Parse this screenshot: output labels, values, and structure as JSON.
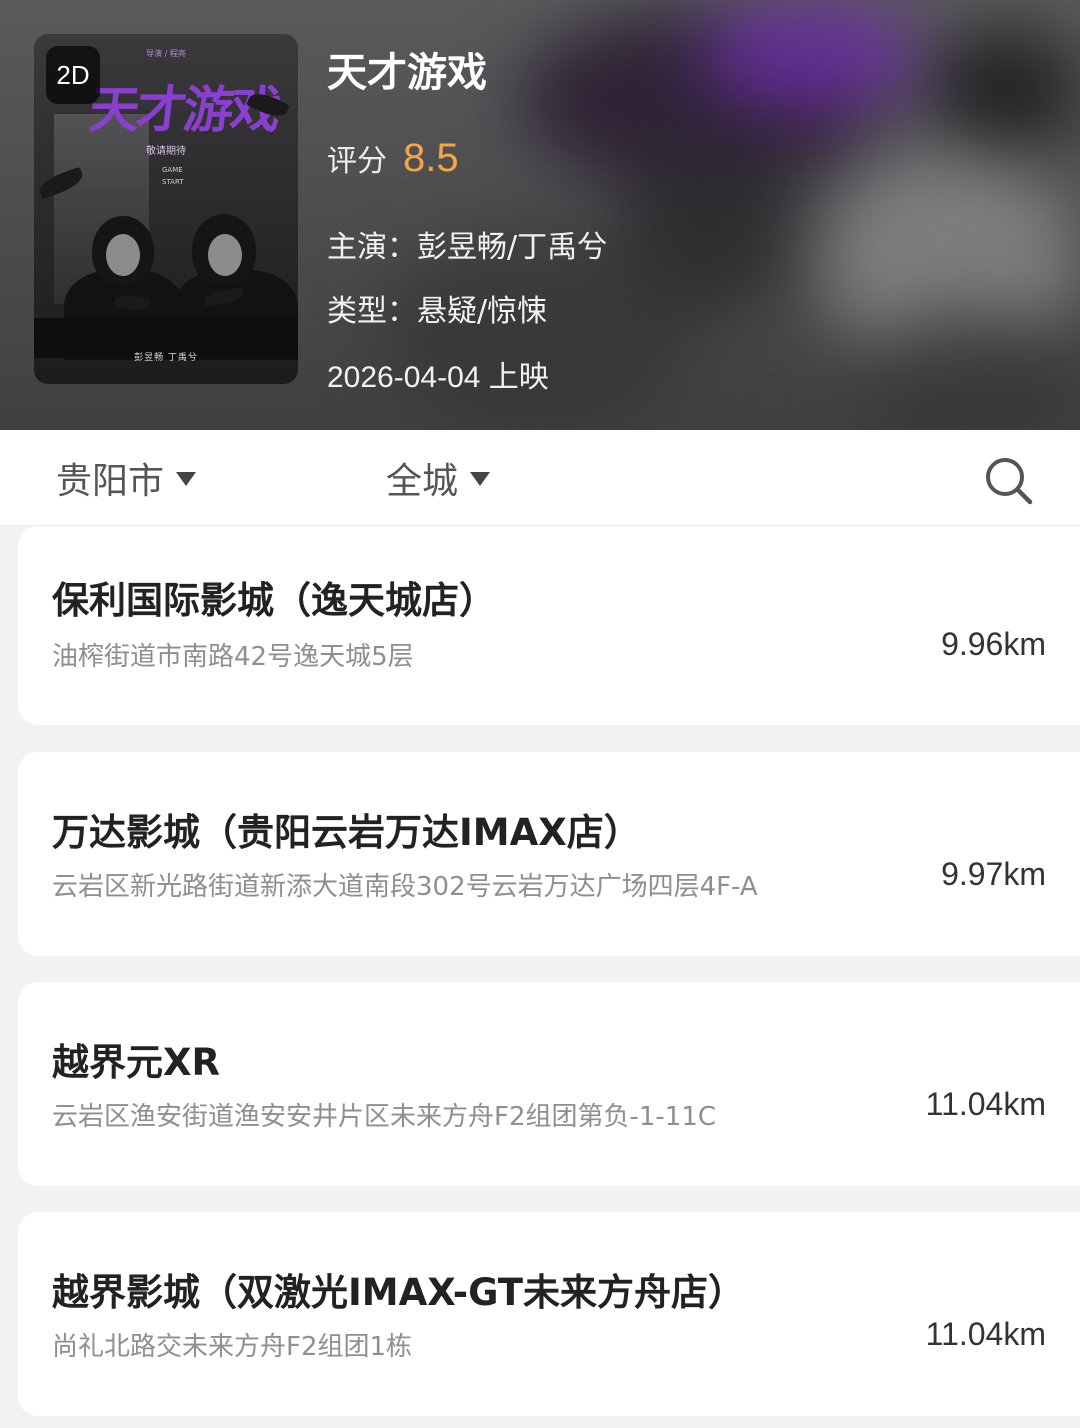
{
  "movie": {
    "badge": "2D",
    "title": "天才游戏",
    "rating_label": "评分",
    "rating_value": "8.5",
    "cast_line": "主演：彭昱畅/丁禹兮",
    "genre_line": "类型：悬疑/惊悚",
    "release_line": "2026-04-04 上映",
    "poster": {
      "title": "天才游戏",
      "credits_top": "导演 / 程亮",
      "subtitle": "敬请期待",
      "vertical_text": "GAME START",
      "cast": "彭昱畅    丁禹兮"
    }
  },
  "filters": {
    "city": "贵阳市",
    "area": "全城",
    "search_icon": "search-icon"
  },
  "colors": {
    "rating": "#f5a642",
    "poster_title": "#8b3fd1"
  },
  "cinemas": [
    {
      "name": "保利国际影城（逸天城店）",
      "address": "油榨街道市南路42号逸天城5层",
      "distance": "9.96km"
    },
    {
      "name": "万达影城（贵阳云岩万达IMAX店）",
      "address": "云岩区新光路街道新添大道南段302号云岩万达广场四层4F-A",
      "distance": "9.97km"
    },
    {
      "name": "越界元XR",
      "address": "云岩区渔安街道渔安安井片区未来方舟F2组团第负-1-11C",
      "distance": "11.04km"
    },
    {
      "name": "越界影城（双激光IMAX-GT未来方舟店）",
      "address": "尚礼北路交未来方舟F2组团1栋",
      "distance": "11.04km"
    }
  ]
}
